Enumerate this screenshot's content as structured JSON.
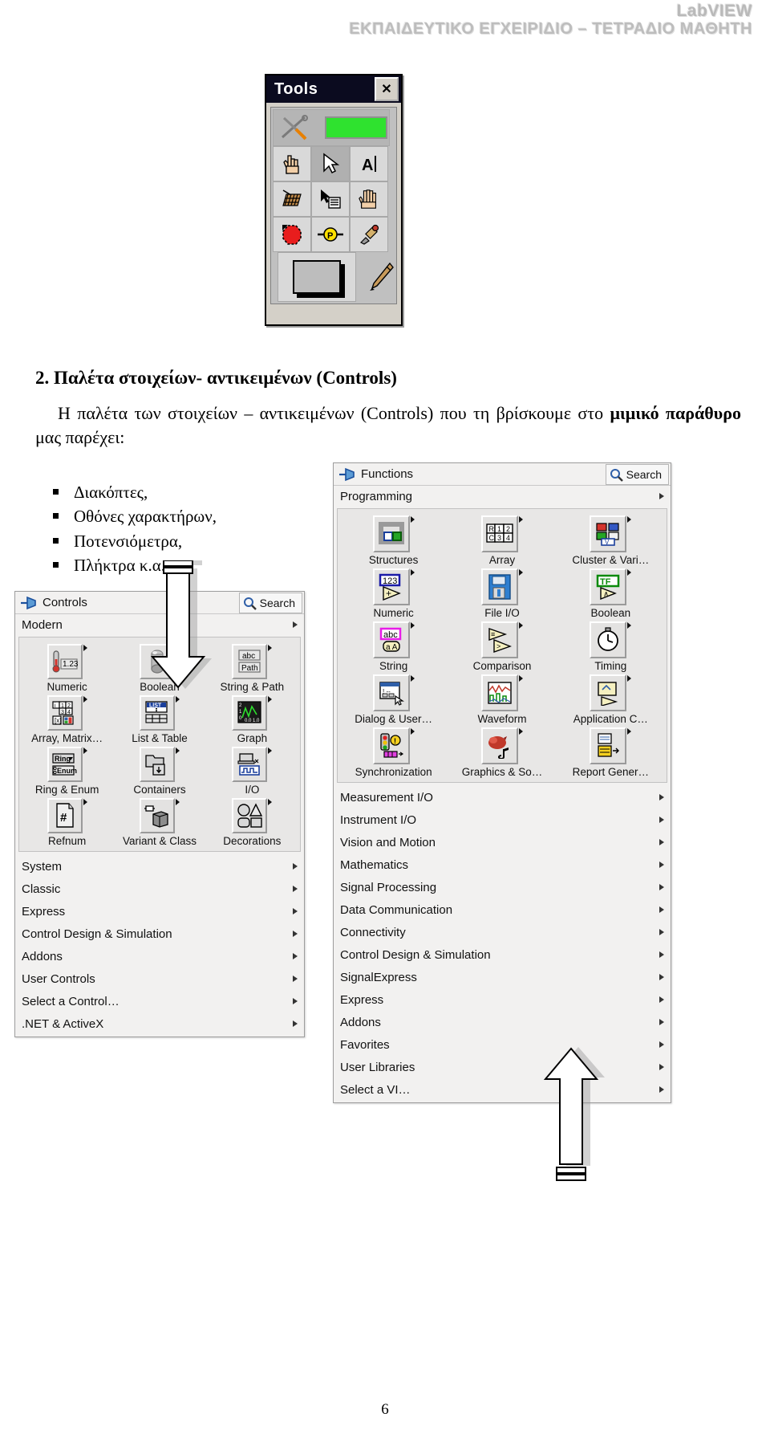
{
  "header": {
    "brand": "LabVIEW",
    "subtitle": "ΕΚΠΑΙΔΕΥΤΙΚΟ ΕΓΧΕΙΡΙΔΙΟ – ΤΕΤΡΑΔΙΟ ΜΑΘΗΤΗ"
  },
  "tools_window": {
    "title": "Tools",
    "close_label": "✕",
    "items": [
      "automatic-tool-selection-icon",
      "indicator-preview-icon",
      "operate-value-hand-icon",
      "position-size-select-arrow-icon",
      "edit-text-A-icon",
      "scroll-window-icon",
      "set-clear-breakpoint-icon",
      "probe-data-icon",
      "get-color-dropper-icon",
      "color-swatch-icon",
      "set-color-paintbrush-icon"
    ]
  },
  "section": {
    "title": "2. Παλέτα στοιχείων- αντικειμένων (Controls)",
    "paragraph_1": "Η παλέτα των στοιχείων – αντικειμένων (Controls) που τη βρίσκουμε στο",
    "paragraph_2_bold": "μιμικό παράθυρο",
    "paragraph_2_rest": " μας παρέχει:",
    "bullets": [
      "Διακόπτες,",
      "Οθόνες χαρακτήρων,",
      "Ποτενσιόμετρα,",
      "Πλήκτρα κ.α.."
    ]
  },
  "controls_palette": {
    "title": "Controls",
    "search_label": "Search",
    "subcategory": "Modern",
    "grid": [
      {
        "label": "Numeric",
        "icon": "thermometer-numeric-icon"
      },
      {
        "label": "Boolean",
        "icon": "push-button-boolean-icon"
      },
      {
        "label": "String & Path",
        "icon": "abc-path-icon"
      },
      {
        "label": "Array, Matrix…",
        "icon": "array-matrix-cluster-icon"
      },
      {
        "label": "List & Table",
        "icon": "list-table-icon"
      },
      {
        "label": "Graph",
        "icon": "waveform-graph-icon"
      },
      {
        "label": "Ring & Enum",
        "icon": "ring-enum-icon"
      },
      {
        "label": "Containers",
        "icon": "containers-folder-icon"
      },
      {
        "label": "I/O",
        "icon": "io-device-waveform-icon"
      },
      {
        "label": "Refnum",
        "icon": "refnum-hash-page-icon"
      },
      {
        "label": "Variant & Class",
        "icon": "variant-class-cube-icon"
      },
      {
        "label": "Decorations",
        "icon": "decorations-shapes-icon"
      }
    ],
    "menu": [
      "System",
      "Classic",
      "Express",
      "Control Design & Simulation",
      "Addons",
      "User Controls",
      "Select a Control…",
      ".NET & ActiveX"
    ]
  },
  "functions_palette": {
    "title": "Functions",
    "search_label": "Search",
    "subcategory": "Programming",
    "grid": [
      {
        "label": "Structures",
        "icon": "structures-loop-icon"
      },
      {
        "label": "Array",
        "icon": "array-grid-icon"
      },
      {
        "label": "Cluster & Vari…",
        "icon": "cluster-variant-icon"
      },
      {
        "label": "Numeric",
        "icon": "numeric-add-icon"
      },
      {
        "label": "File I/O",
        "icon": "file-io-floppy-icon"
      },
      {
        "label": "Boolean",
        "icon": "boolean-tf-and-icon"
      },
      {
        "label": "String",
        "icon": "string-abc-icon"
      },
      {
        "label": "Comparison",
        "icon": "comparison-greater-icon"
      },
      {
        "label": "Timing",
        "icon": "timing-clock-icon"
      },
      {
        "label": "Dialog & User…",
        "icon": "dialog-user-interface-icon"
      },
      {
        "label": "Waveform",
        "icon": "waveform-chart-icon"
      },
      {
        "label": "Application C…",
        "icon": "application-control-icon"
      },
      {
        "label": "Synchronization",
        "icon": "synchronization-semaphore-icon"
      },
      {
        "label": "Graphics & So…",
        "icon": "graphics-sound-icon"
      },
      {
        "label": "Report Gener…",
        "icon": "report-generation-icon"
      }
    ],
    "menu": [
      "Measurement I/O",
      "Instrument I/O",
      "Vision and Motion",
      "Mathematics",
      "Signal Processing",
      "Data Communication",
      "Connectivity",
      "Control Design & Simulation",
      "SignalExpress",
      "Express",
      "Addons",
      "Favorites",
      "User Libraries",
      "Select a VI…"
    ]
  },
  "annotations": {
    "arrow_down": "down-block-arrow",
    "arrow_up": "up-block-arrow"
  },
  "page_number": "6",
  "colors": {
    "title_bar": "#0b0b1f",
    "palette_bg": "#f2f1f0",
    "grid_bg": "#e8e7e6",
    "header_grey": "#bdbdbd"
  }
}
